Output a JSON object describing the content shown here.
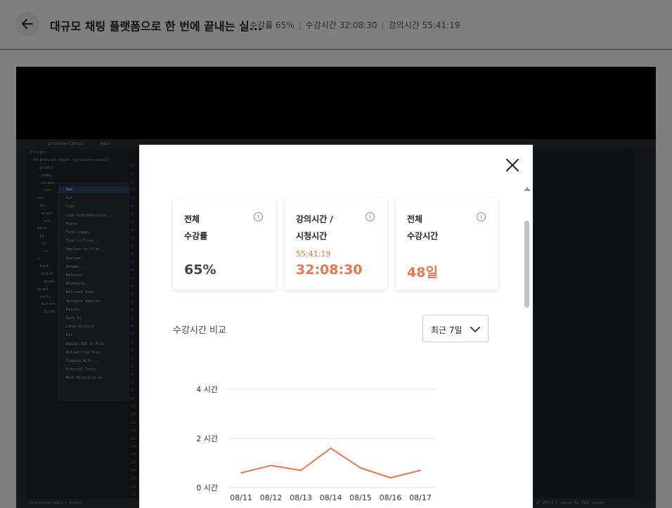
{
  "header": {
    "title": "대규모 채팅 플랫폼으로 한 번에 끝내는 실...",
    "progress_text": "수강률 65%",
    "watch_time_text": "수강시간 32:08:30",
    "lecture_time_text": "강의시간 55:41:19"
  },
  "video_ide": {
    "branch": "preview-consul",
    "main_branch": "main",
    "project_label": "Project",
    "tree_root": "04-preview-nginx [preview-consul]",
    "tree_rows": [
      ".gradle",
      ".idea",
      "docker",
      "con",
      "con",
      "doc",
      "gradl",
      "src",
      "main",
      "ja",
      "re",
      "cc",
      "c",
      "test",
      "build",
      "gradl",
      "gradl",
      "setti",
      "Extern",
      "Scrat"
    ],
    "line_numbers": [
      "70",
      "71",
      "72",
      "73",
      "74",
      "75",
      "76",
      "77",
      "78",
      "79",
      "80",
      "81",
      "82",
      "83",
      "84",
      "85",
      "86",
      "87",
      "88",
      "89",
      "90",
      "91",
      "92",
      "93",
      "94",
      "95",
      "96",
      "97",
      "98",
      "99",
      "100",
      "101",
      "102",
      "103",
      "104",
      "105",
      "106",
      "107",
      "108",
      "109",
      "110",
      "111",
      "112"
    ],
    "context_menu": [
      "New",
      "Cut",
      "Copy",
      "Copy Path/Reference...",
      "Paste",
      "Find Usages",
      "Find in Files...",
      "Replace in Files...",
      "Analyze",
      "Rename...",
      "Refactor",
      "Bookmarks",
      "Reformat Code",
      "Optimize Imports",
      "Delete...",
      "Open In",
      "Local History",
      "Git",
      "Repair IDE on File",
      "Reload from Disk",
      "Compare With...",
      "External Tools",
      "Mark Directory as"
    ],
    "status_left": "04-preview-nginx > docker",
    "status_right": "LF   UTF-8   2 spaces   No JSON schema"
  },
  "modal": {
    "cards": [
      {
        "label1": "전체",
        "label2": "수강률",
        "sub": "",
        "value": "65%",
        "value_color": "#444444"
      },
      {
        "label1": "강의시간 /",
        "label2": "시청시간",
        "sub": "55:41:19",
        "value": "32:08:30",
        "value_color": "#e8774e"
      },
      {
        "label1": "전체",
        "label2": "수강시간",
        "sub": "",
        "value": "48일",
        "value_color": "#e8774e"
      }
    ],
    "info_glyph": "i",
    "section_title": "수강시간 비교",
    "select_value": "최근 7일"
  },
  "chart_data": {
    "type": "line",
    "categories": [
      "08/11",
      "08/12",
      "08/13",
      "08/14",
      "08/15",
      "08/16",
      "08/17"
    ],
    "values": [
      0.6,
      0.9,
      0.7,
      1.6,
      0.8,
      0.4,
      0.7
    ],
    "ytick_labels": [
      "0 시간",
      "2 시간",
      "4 시간"
    ],
    "yticks": [
      0,
      2,
      4
    ],
    "ylim": [
      0,
      4
    ],
    "line_color": "#e8774e",
    "grid": true
  },
  "colors": {
    "accent": "#e8774e",
    "overlay": "rgba(0,0,0,0.5)"
  }
}
